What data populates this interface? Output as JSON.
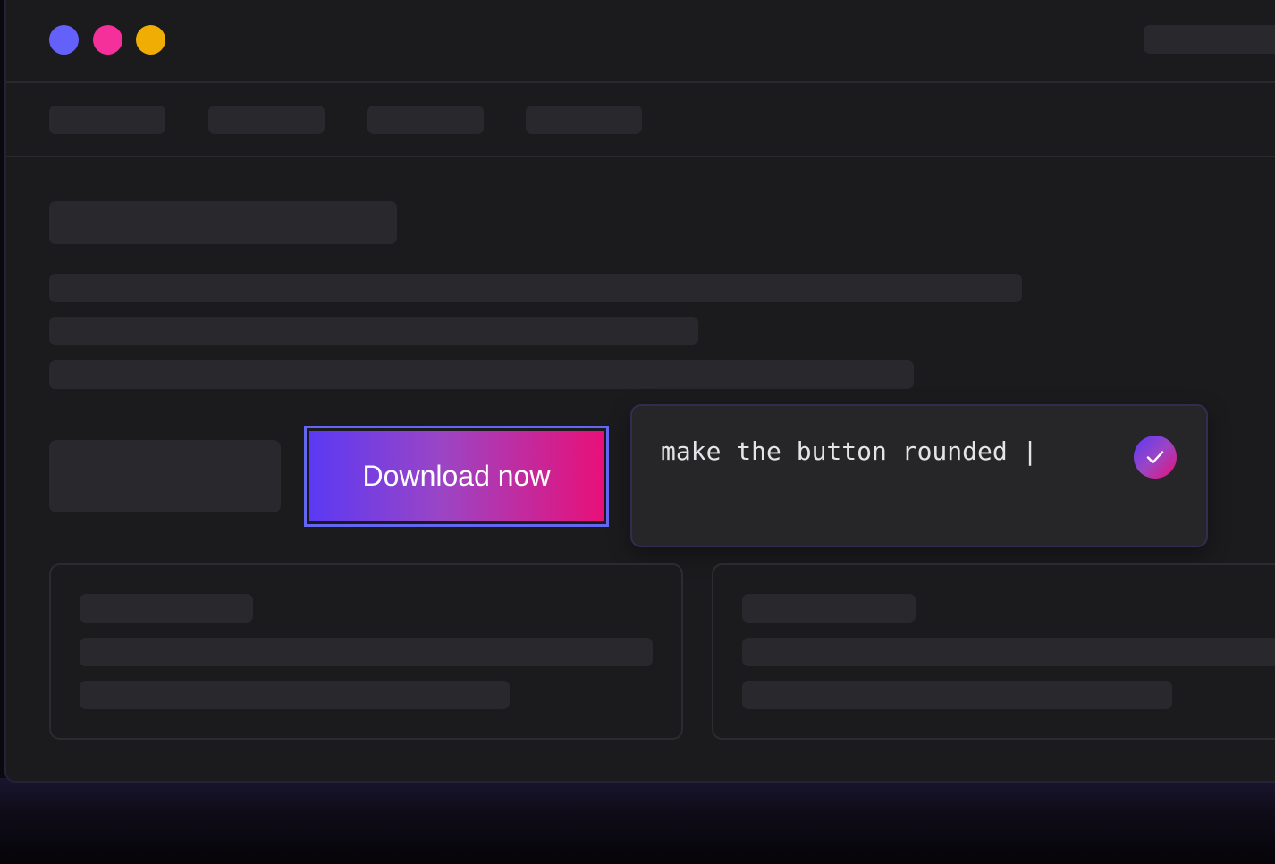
{
  "window": {
    "controls": [
      {
        "name": "window-dot-purple",
        "color": "#6461fb"
      },
      {
        "name": "window-dot-pink",
        "color": "#f6309a"
      },
      {
        "name": "window-dot-yellow",
        "color": "#f0ad04"
      }
    ]
  },
  "main": {
    "download_button": {
      "label": "Download now"
    }
  },
  "prompt": {
    "text": "make the button rounded |",
    "submit_icon": "check-icon"
  },
  "colors": {
    "accent_start": "#5b39f3",
    "accent_end": "#e81078",
    "focus_outline": "#6366f1",
    "window_bg": "#1b1b1e",
    "skeleton": "#29292d"
  }
}
